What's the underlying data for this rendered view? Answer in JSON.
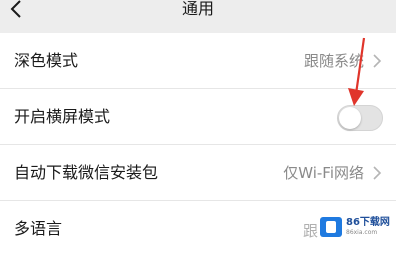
{
  "header": {
    "title": "通用",
    "back_icon": "chevron-left-icon"
  },
  "settings": [
    {
      "label": "深色模式",
      "value": "跟随系统",
      "type": "link"
    },
    {
      "label": "开启横屏模式",
      "type": "toggle",
      "enabled": false
    },
    {
      "label": "自动下载微信安装包",
      "value": "仅Wi-Fi网络",
      "type": "link"
    },
    {
      "label": "多语言",
      "value": "跟",
      "type": "link"
    }
  ],
  "annotation": {
    "color": "#e0352b",
    "icon": "red-arrow-annotation-icon"
  },
  "watermark": {
    "main": "86下载网",
    "sub": "86xia.com"
  },
  "colors": {
    "background": "#ededed",
    "card": "#ffffff",
    "secondary_text": "#8a8a8a"
  }
}
